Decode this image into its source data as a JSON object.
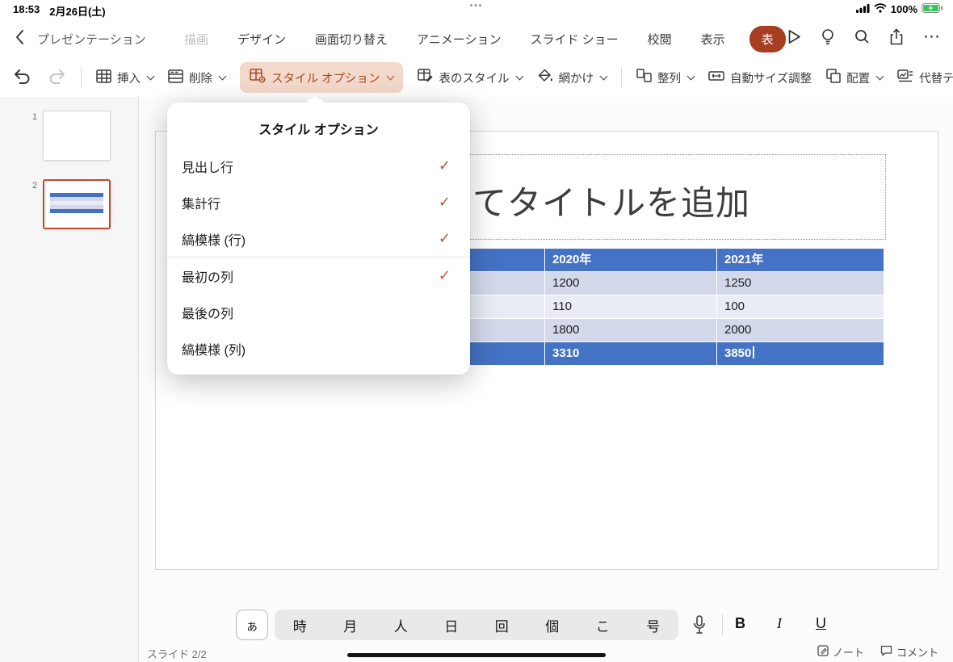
{
  "status_bar": {
    "time": "18:53",
    "date": "2月26日(土)",
    "battery_percent": "100%"
  },
  "icons": {
    "multitask_dots": "•••",
    "more": "⋯",
    "check": "✓"
  },
  "nav": {
    "back_label": "プレゼンテーション",
    "tabs": {
      "draw": "描画",
      "design": "デザイン",
      "transitions": "画面切り替え",
      "animations": "アニメーション",
      "slideshow": "スライド ショー",
      "review": "校閲",
      "view": "表示",
      "table_contextual": "表"
    }
  },
  "toolbar": {
    "insert": "挿入",
    "delete": "削除",
    "style_options": "スタイル オプション",
    "table_styles": "表のスタイル",
    "shading": "網かけ",
    "align": "整列",
    "autofit": "自動サイズ調整",
    "arrange": "配置",
    "alt_text": "代替テキスト"
  },
  "style_options_popup": {
    "title": "スタイル オプション",
    "items": [
      {
        "label": "見出し行",
        "checked": true
      },
      {
        "label": "集計行",
        "checked": true
      },
      {
        "label": "縞模様 (行)",
        "checked": true
      },
      {
        "label": "最初の列",
        "checked": true
      },
      {
        "label": "最後の列",
        "checked": false
      },
      {
        "label": "縞模様 (列)",
        "checked": false
      }
    ]
  },
  "slides_panel": {
    "slide1_number": "1",
    "slide2_number": "2"
  },
  "slide": {
    "title_placeholder_visible": "てタイトルを追加",
    "table": {
      "header": [
        "",
        "2020年",
        "2021年"
      ],
      "rows": [
        [
          "",
          "1200",
          "1250"
        ],
        [
          "",
          "110",
          "100"
        ],
        [
          "",
          "1800",
          "2000"
        ]
      ],
      "total": [
        "",
        "3310",
        "3850"
      ]
    }
  },
  "input_bar": {
    "kana_toggle": "ぁ",
    "suggestions": [
      "時",
      "月",
      "人",
      "日",
      "回",
      "個",
      "こ",
      "号"
    ],
    "bold": "B",
    "italic": "I",
    "underline": "U"
  },
  "footer": {
    "slide_counter": "スライド 2/2",
    "notes": "ノート",
    "comments": "コメント"
  }
}
